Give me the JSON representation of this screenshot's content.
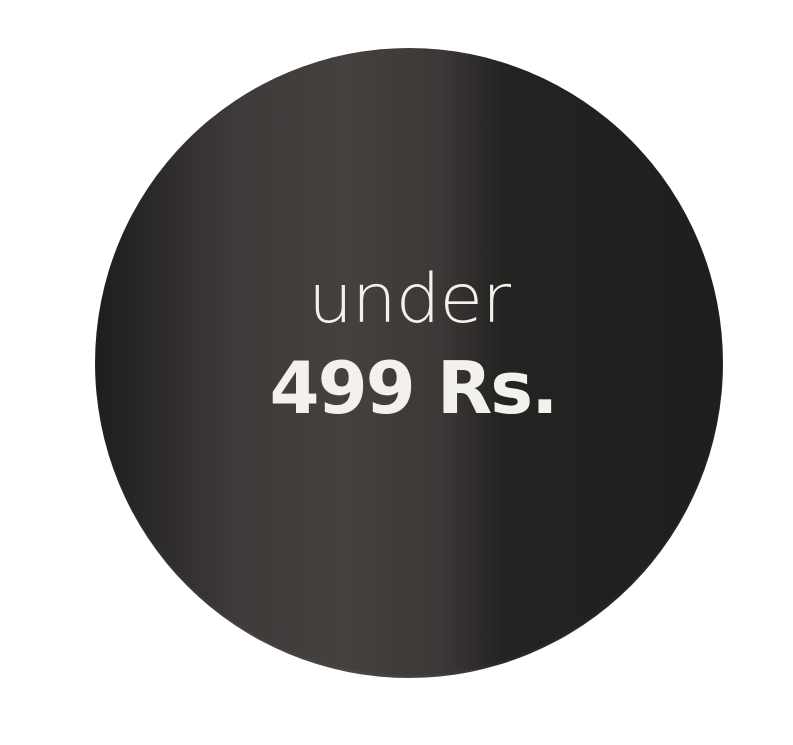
{
  "badge": {
    "line1": "under",
    "line2": "499 Rs."
  },
  "colors": {
    "background": "#ffffff",
    "badge_dark": "#1f1d1c",
    "badge_highlight": "#45413f",
    "text": "#f3f1ec"
  }
}
